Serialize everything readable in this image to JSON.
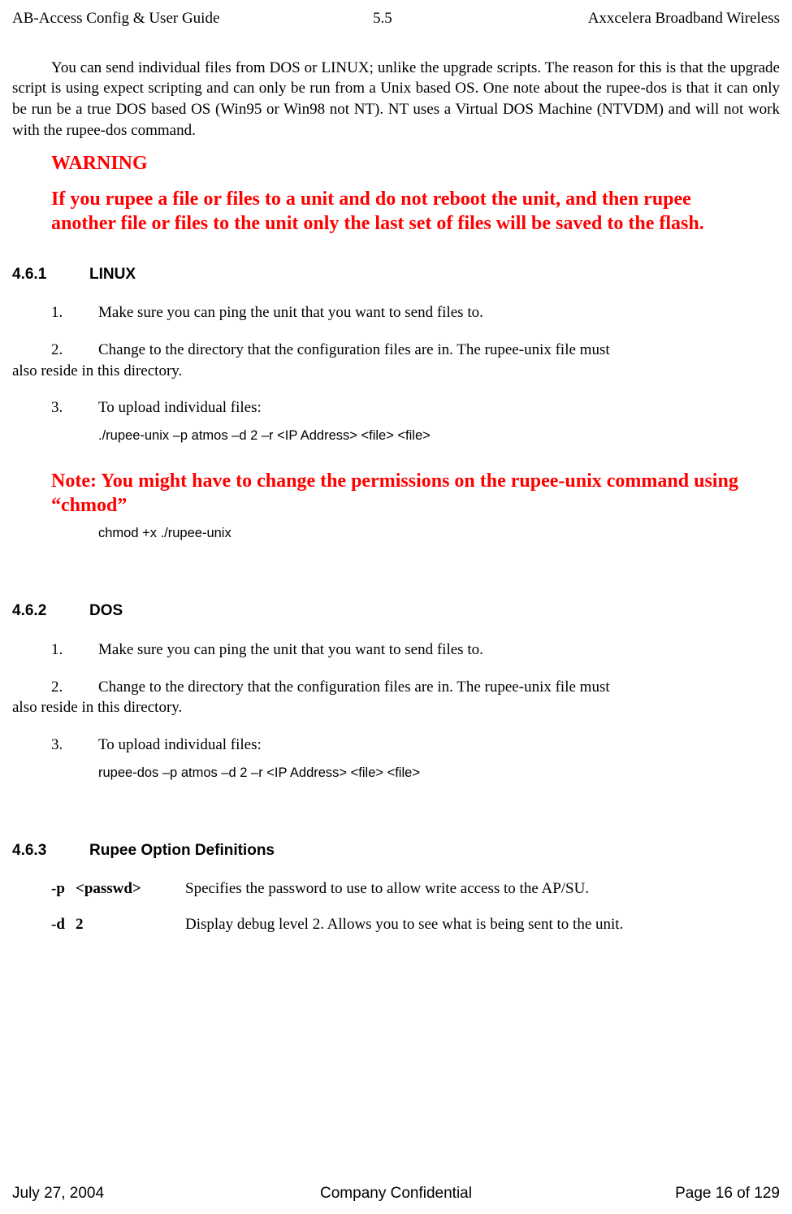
{
  "header": {
    "left": "AB-Access Config & User Guide",
    "center": "5.5",
    "right": "Axxcelera Broadband Wireless"
  },
  "intro": "You can send individual files from DOS or LINUX; unlike the upgrade scripts. The reason for this is that the upgrade script is using expect scripting and can only be run from a Unix based OS. One note about the rupee-dos is that it can only be run be a true DOS based OS (Win95 or Win98 not NT). NT uses a Virtual DOS Machine (NTVDM) and will not work with the rupee-dos command.",
  "warning": {
    "title": "WARNING",
    "body": "If you rupee a file or files to a unit and do not reboot the unit, and then rupee another file or files to the unit only the last set of files will be saved to the flash."
  },
  "sections": {
    "s461": {
      "num": "4.6.1",
      "title": "LINUX",
      "items": {
        "i1": {
          "num": "1.",
          "text": "Make sure you can ping the unit that you want to send files to."
        },
        "i2": {
          "num": "2.",
          "first": "Change to the directory that the configuration files are in. The rupee-unix file must",
          "cont": "also reside in this directory."
        },
        "i3": {
          "num": "3.",
          "text": "To upload individual files:"
        }
      },
      "code1": "./rupee-unix   –p   atmos   –d   2   –r   <IP Address>   <file>   <file>",
      "note": "Note: You might have to change the permissions on the rupee-unix command using “chmod”",
      "code2": "chmod   +x    ./rupee-unix"
    },
    "s462": {
      "num": "4.6.2",
      "title": "DOS",
      "items": {
        "i1": {
          "num": "1.",
          "text": "Make sure you can ping the unit that you want to send files to."
        },
        "i2": {
          "num": "2.",
          "first": "Change to the directory that the configuration files are in. The rupee-unix file must",
          "cont": "also reside in this directory."
        },
        "i3": {
          "num": "3.",
          "text": "To upload individual files:"
        }
      },
      "code1": "rupee-dos   –p   atmos   –d   2   –r   <IP Address>   <file>   <file>"
    },
    "s463": {
      "num": "4.6.3",
      "title": "Rupee Option Definitions",
      "options": {
        "o1": {
          "flag": "-p",
          "arg": "<passwd>",
          "desc": "Specifies the password to use to allow write access to the AP/SU."
        },
        "o2": {
          "flag": "-d",
          "arg": "2",
          "desc": "Display debug level 2.  Allows you to see what is being sent to the unit."
        }
      }
    }
  },
  "footer": {
    "left": "July 27, 2004",
    "center": "Company Confidential",
    "right": "Page 16 of 129"
  }
}
